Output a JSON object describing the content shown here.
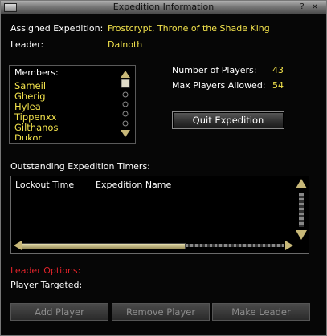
{
  "window": {
    "title": "Expedition Information",
    "help_label": "?",
    "close_label": "×"
  },
  "info": {
    "assigned_label": "Assigned Expedition:",
    "assigned_value": "Frostcrypt, Throne of the Shade King",
    "leader_label": "Leader:",
    "leader_value": "Dalnoth",
    "players_label": "Number of Players:",
    "players_value": "43",
    "max_label": "Max Players Allowed:",
    "max_value": "54"
  },
  "members": {
    "label": "Members:",
    "items": [
      "Sameil",
      "Gherig",
      "Hylea",
      "Tippenxx",
      "Gilthanos",
      "Dukor"
    ]
  },
  "quit_button": "Quit Expedition",
  "timers": {
    "label": "Outstanding Expedition Timers:",
    "columns": [
      "Lockout Time",
      "Expedition Name"
    ]
  },
  "leader_options": {
    "label": "Leader Options:",
    "player_targeted_label": "Player Targeted:",
    "buttons": [
      "Add Player",
      "Remove Player",
      "Make Leader"
    ]
  },
  "colors": {
    "accent_yellow": "#f2e24c",
    "leader_red": "#e0232a"
  }
}
